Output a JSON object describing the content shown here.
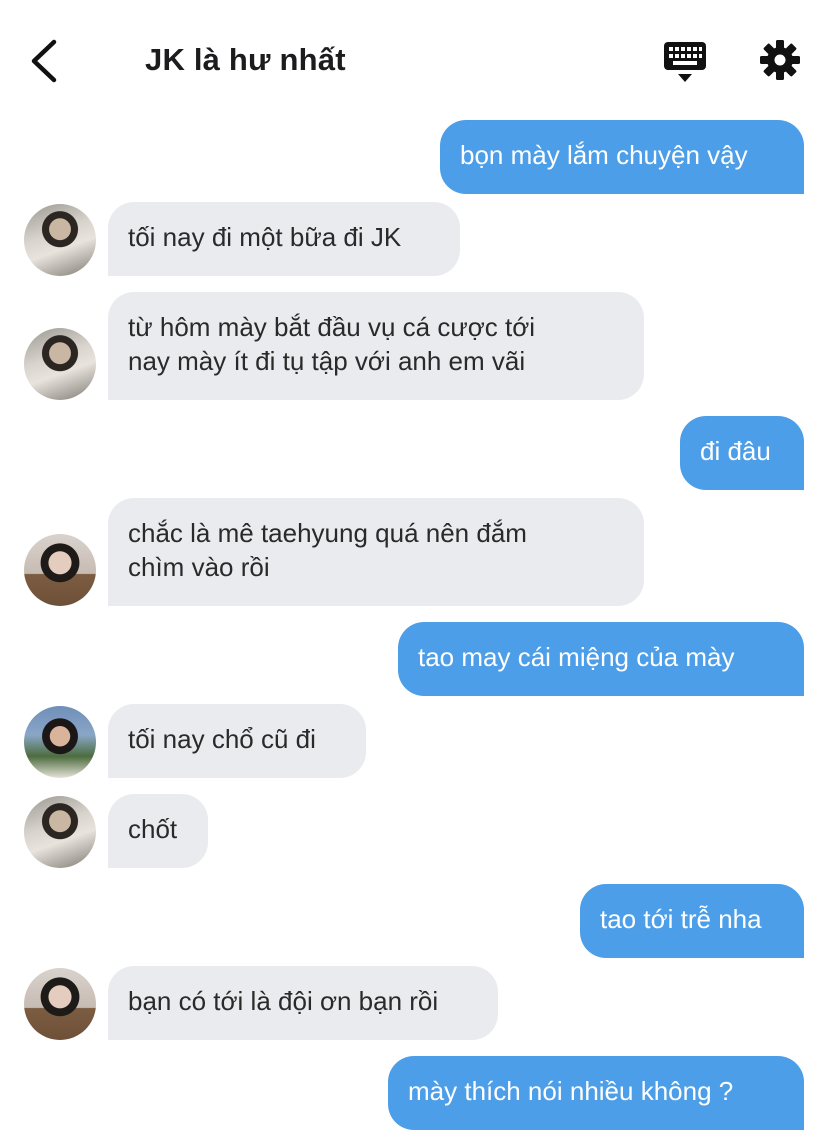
{
  "header": {
    "title": "JK là hư nhất",
    "back_icon": "chevron-left-icon",
    "keyboard_icon": "keyboard-icon",
    "settings_icon": "gear-icon"
  },
  "colors": {
    "outgoing_bubble": "#4d9ee8",
    "incoming_bubble": "#e9ebee",
    "incoming_text": "#2a2a2a"
  },
  "messages": [
    {
      "direction": "out",
      "text": [
        "bọn mày lắm chuyện vậy"
      ]
    },
    {
      "direction": "in",
      "avatar": "a",
      "text": [
        "tối nay đi một bữa đi JK"
      ]
    },
    {
      "direction": "in",
      "avatar": "a",
      "text": [
        "từ hôm mày bắt đầu vụ cá cược tới",
        "nay mày ít đi tụ tập với anh em vãi"
      ]
    },
    {
      "direction": "out",
      "text": [
        "đi đâu"
      ]
    },
    {
      "direction": "in",
      "avatar": "b",
      "text": [
        "chắc là mê taehyung quá nên đắm",
        "chìm vào rồi"
      ]
    },
    {
      "direction": "out",
      "text": [
        "tao may cái miệng của mày"
      ]
    },
    {
      "direction": "in",
      "avatar": "c",
      "text": [
        "tối nay chổ cũ đi"
      ]
    },
    {
      "direction": "in",
      "avatar": "a",
      "text": [
        "chốt"
      ]
    },
    {
      "direction": "out",
      "text": [
        "tao tới trễ nha"
      ]
    },
    {
      "direction": "in",
      "avatar": "b",
      "text": [
        "bạn có tới là đội ơn bạn rồi"
      ]
    },
    {
      "direction": "out",
      "text": [
        "mày thích nói nhiều không ?"
      ]
    }
  ]
}
